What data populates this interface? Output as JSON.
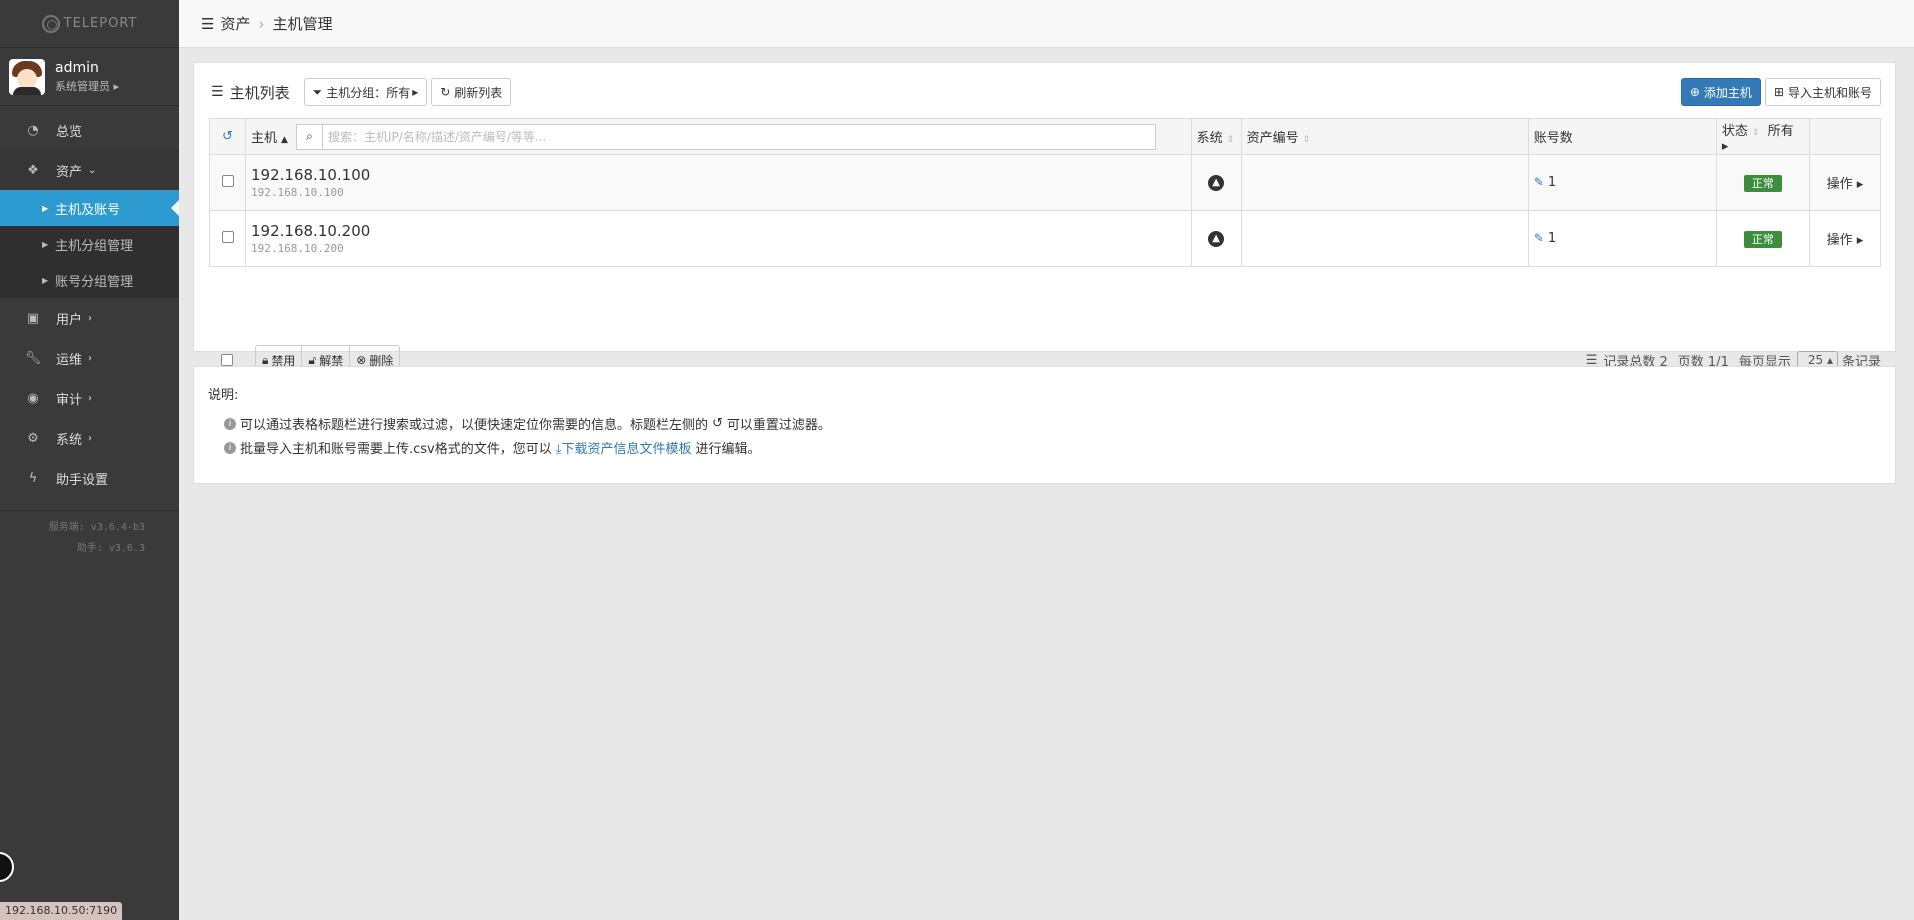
{
  "app": {
    "logo_text": "TELEPORT"
  },
  "user": {
    "name": "admin",
    "role": "系统管理员"
  },
  "menu": {
    "overview": "总览",
    "assets": "资产",
    "assets_sub": [
      "主机及账号",
      "主机分组管理",
      "账号分组管理"
    ],
    "users": "用户",
    "ops": "运维",
    "audit": "审计",
    "system": "系统",
    "assistant": "助手设置"
  },
  "versions": {
    "server": "服务端: v3.6.4-b3",
    "assistant": "助手: v3.6.3"
  },
  "status_url": "192.168.10.50:7190",
  "breadcrumb": [
    "资产",
    "主机管理"
  ],
  "toolbar": {
    "title": "主机列表",
    "group_filter": "主机分组：所有",
    "refresh": "刷新列表",
    "add_host": "添加主机",
    "import": "导入主机和账号"
  },
  "table": {
    "headers": {
      "host": "主机",
      "os": "系统",
      "asset_no": "资产编号",
      "accounts": "账号数",
      "status": "状态",
      "status_filter": "所有"
    },
    "search_placeholder": "搜索：主机IP/名称/描述/资产编号/等等...",
    "rows": [
      {
        "ip": "192.168.10.100",
        "sub": "192.168.10.100",
        "os": "linux",
        "asset_no": "",
        "accounts": "1",
        "status": "正常",
        "action": "操作"
      },
      {
        "ip": "192.168.10.200",
        "sub": "192.168.10.200",
        "os": "linux",
        "asset_no": "",
        "accounts": "1",
        "status": "正常",
        "action": "操作"
      }
    ]
  },
  "bulk": {
    "disable": "禁用",
    "unlock": "解禁",
    "delete": "删除"
  },
  "pager": {
    "total": "记录总数 2",
    "pages": "页数 1/1",
    "per_page_label": "每页显示",
    "per_page": "25",
    "unit": "条记录"
  },
  "notes": {
    "title": "说明:",
    "line1": "可以通过表格标题栏进行搜索或过滤，以便快速定位你需要的信息。标题栏左侧的",
    "line1_tail": "可以重置过滤器。",
    "line2": "批量导入主机和账号需要上传.csv格式的文件，您可以",
    "line2_link": "下载资产信息文件模板",
    "line2_tail": "进行编辑。"
  }
}
